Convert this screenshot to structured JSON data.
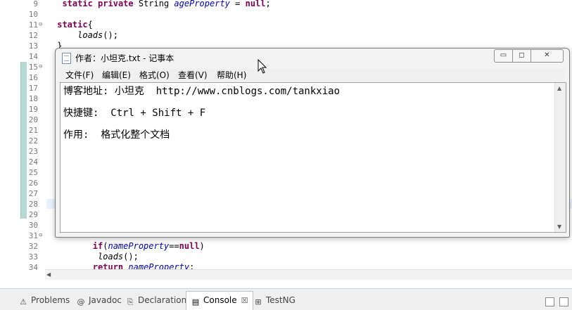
{
  "editor": {
    "lines": [
      {
        "num": "9",
        "fold": "",
        "code": [
          {
            "t": "  "
          },
          {
            "t": "static",
            "c": "kw"
          },
          {
            "t": " "
          },
          {
            "t": "private",
            "c": "kw"
          },
          {
            "t": " String "
          },
          {
            "t": "ageProperty",
            "c": "field"
          },
          {
            "t": " = "
          },
          {
            "t": "null",
            "c": "kw"
          },
          {
            "t": ";"
          }
        ]
      },
      {
        "num": "10",
        "fold": "",
        "code": []
      },
      {
        "num": "11",
        "fold": "⊖",
        "code": [
          {
            "t": " "
          },
          {
            "t": "static",
            "c": "kw"
          },
          {
            "t": "{"
          }
        ]
      },
      {
        "num": "12",
        "fold": "",
        "code": [
          {
            "t": "     "
          },
          {
            "t": "loads",
            "c": "it"
          },
          {
            "t": "();"
          }
        ]
      },
      {
        "num": "13",
        "fold": "",
        "code": [
          {
            "t": " }"
          }
        ]
      },
      {
        "num": "14",
        "fold": "",
        "code": []
      },
      {
        "num": "15",
        "fold": "⊖",
        "code": []
      },
      {
        "num": "16",
        "fold": "",
        "code": []
      },
      {
        "num": "17",
        "fold": "",
        "code": []
      },
      {
        "num": "18",
        "fold": "",
        "code": []
      },
      {
        "num": "19",
        "fold": "",
        "code": []
      },
      {
        "num": "20",
        "fold": "",
        "code": []
      },
      {
        "num": "21",
        "fold": "",
        "code": []
      },
      {
        "num": "22",
        "fold": "",
        "code": []
      },
      {
        "num": "23",
        "fold": "",
        "code": []
      },
      {
        "num": "24",
        "fold": "",
        "code": []
      },
      {
        "num": "25",
        "fold": "",
        "code": []
      },
      {
        "num": "26",
        "fold": "",
        "code": []
      },
      {
        "num": "27",
        "fold": "",
        "code": []
      },
      {
        "num": "28",
        "fold": "",
        "code": []
      },
      {
        "num": "29",
        "fold": "",
        "code": []
      },
      {
        "num": "30",
        "fold": "",
        "code": []
      },
      {
        "num": "31",
        "fold": "⊖",
        "code": []
      },
      {
        "num": "32",
        "fold": "",
        "code": [
          {
            "t": "        "
          },
          {
            "t": "if",
            "c": "kw"
          },
          {
            "t": "("
          },
          {
            "t": "nameProperty",
            "c": "field"
          },
          {
            "t": "=="
          },
          {
            "t": "null",
            "c": "kw"
          },
          {
            "t": ")"
          }
        ]
      },
      {
        "num": "33",
        "fold": "",
        "code": [
          {
            "t": "         "
          },
          {
            "t": "loads",
            "c": "it"
          },
          {
            "t": "();"
          }
        ]
      },
      {
        "num": "34",
        "fold": "",
        "code": [
          {
            "t": "        "
          },
          {
            "t": "return",
            "c": "kw"
          },
          {
            "t": " "
          },
          {
            "t": "nameProperty",
            "c": "field"
          },
          {
            "t": ";"
          }
        ]
      }
    ]
  },
  "notepad": {
    "title": "作者：小坦克.txt - 记事本",
    "menu": [
      "文件(F)",
      "编辑(E)",
      "格式(O)",
      "查看(V)",
      "帮助(H)"
    ],
    "min_glyph": "▭",
    "max_glyph": "◻",
    "close_glyph": "✕",
    "lines": [
      "博客地址: 小坦克  http://www.cnblogs.com/tankxiao",
      "快捷键:  Ctrl + Shift + F",
      "作用:  格式化整个文档"
    ]
  },
  "views": {
    "tabs": [
      {
        "label": "Problems",
        "icon": "problems-icon",
        "glyph": "⚠"
      },
      {
        "label": "Javadoc",
        "icon": "javadoc-icon",
        "glyph": "@"
      },
      {
        "label": "Declaration",
        "icon": "declaration-icon",
        "glyph": "⎘"
      },
      {
        "label": "Console",
        "icon": "console-icon",
        "glyph": "▤",
        "active": true
      },
      {
        "label": "TestNG",
        "icon": "testng-icon",
        "glyph": "⊞"
      }
    ],
    "close_glyph": "☒"
  },
  "colors": {
    "keyword": "#7f0055",
    "field": "#0000c0",
    "change_marker": "#b7d9d4"
  }
}
